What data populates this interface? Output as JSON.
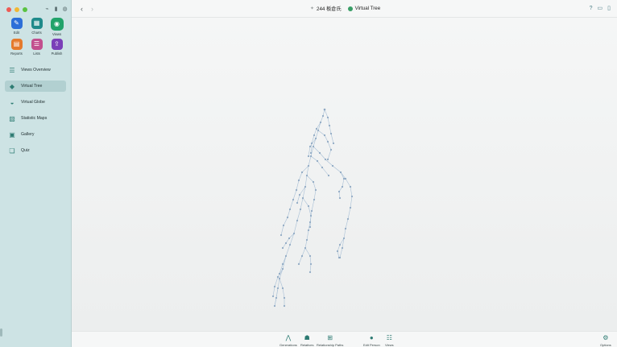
{
  "sidebar": {
    "tiles": [
      {
        "label": "Edit",
        "icon": "pencil-icon",
        "color": "#2d6fd8"
      },
      {
        "label": "Charts",
        "icon": "charts-icon",
        "color": "#1f8a8a"
      },
      {
        "label": "Views",
        "icon": "eye-icon",
        "color": "#21a36a"
      },
      {
        "label": "Reports",
        "icon": "document-icon",
        "color": "#e57a2c"
      },
      {
        "label": "Lists",
        "icon": "list-icon",
        "color": "#c24f8e"
      },
      {
        "label": "Publish",
        "icon": "publish-icon",
        "color": "#7a3fb8"
      }
    ],
    "nav": [
      {
        "label": "Views Overview",
        "icon": "list-lines-icon"
      },
      {
        "label": "Virtual Tree",
        "icon": "cube-icon",
        "active": true
      },
      {
        "label": "Virtual Globe",
        "icon": "globe-icon"
      },
      {
        "label": "Statistic Maps",
        "icon": "map-icon"
      },
      {
        "label": "Gallery",
        "icon": "gallery-icon"
      },
      {
        "label": "Quiz",
        "icon": "quiz-icon"
      }
    ]
  },
  "header": {
    "person": "244 板倉氏",
    "view": "Virtual Tree"
  },
  "bottom": {
    "buttons": [
      {
        "label": "Generations",
        "icon": "generations-icon"
      },
      {
        "label": "Relatives",
        "icon": "relatives-icon"
      },
      {
        "label": "Relationship Paths",
        "icon": "relationship-paths-icon"
      },
      {
        "label": "Edit Person",
        "icon": "edit-person-icon"
      },
      {
        "label": "Views",
        "icon": "views-icon"
      },
      {
        "label": "Options",
        "icon": "gear-icon"
      }
    ]
  },
  "colors": {
    "accent": "#2c7a72",
    "sidebar_bg": "#cde3e4",
    "tree_line": "#9fb8d0",
    "tree_node": "#7f9fbd"
  }
}
